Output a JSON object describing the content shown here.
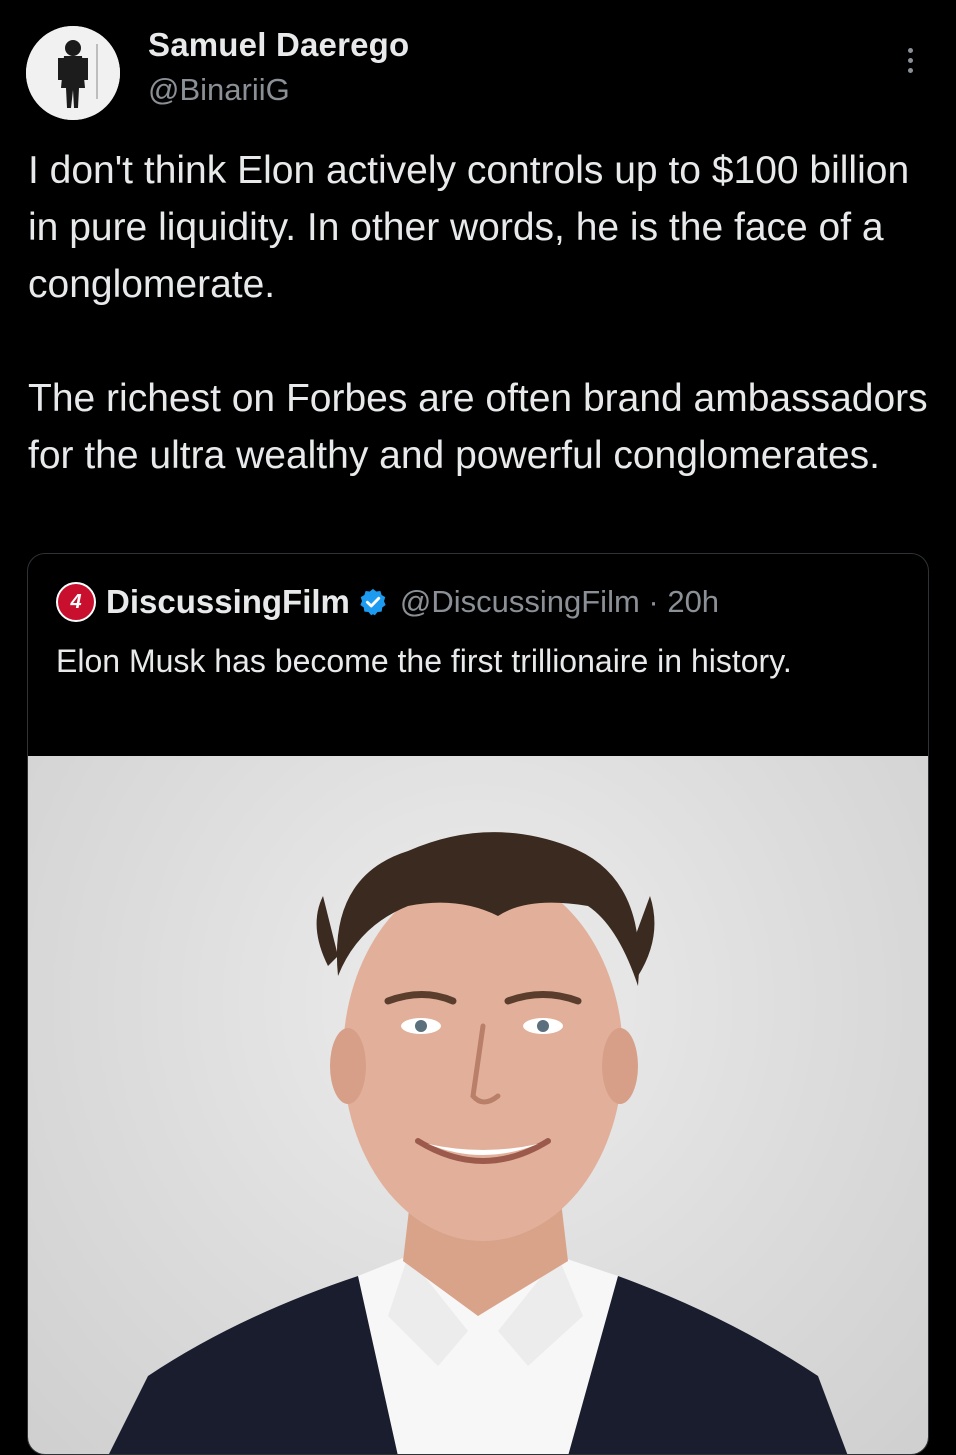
{
  "post": {
    "author_name": "Samuel Daerego",
    "author_handle": "@BinariiG",
    "paragraphs": [
      "I don't think Elon actively controls up to $100 billion in pure liquidity. In other words, he is the face of a conglomerate.",
      "The richest on Forbes are often brand ambassadors for the ultra wealthy and powerful conglomerates."
    ],
    "icons": {
      "avatar": "avatar",
      "menu": "more-options-icon"
    }
  },
  "quote": {
    "author_name": "DiscussingFilm",
    "avatar_glyph": "4",
    "verified": true,
    "meta": "@DiscussingFilm · 20h",
    "text": "Elon Musk has become the first trillionaire in history.",
    "colors": {
      "avatar_bg": "#c8102e",
      "verified_badge": "#1d9bf0"
    }
  },
  "colors": {
    "background": "#000000",
    "text_primary": "#e7e9ea",
    "text_secondary": "#8b9096",
    "border": "#2f3336"
  }
}
